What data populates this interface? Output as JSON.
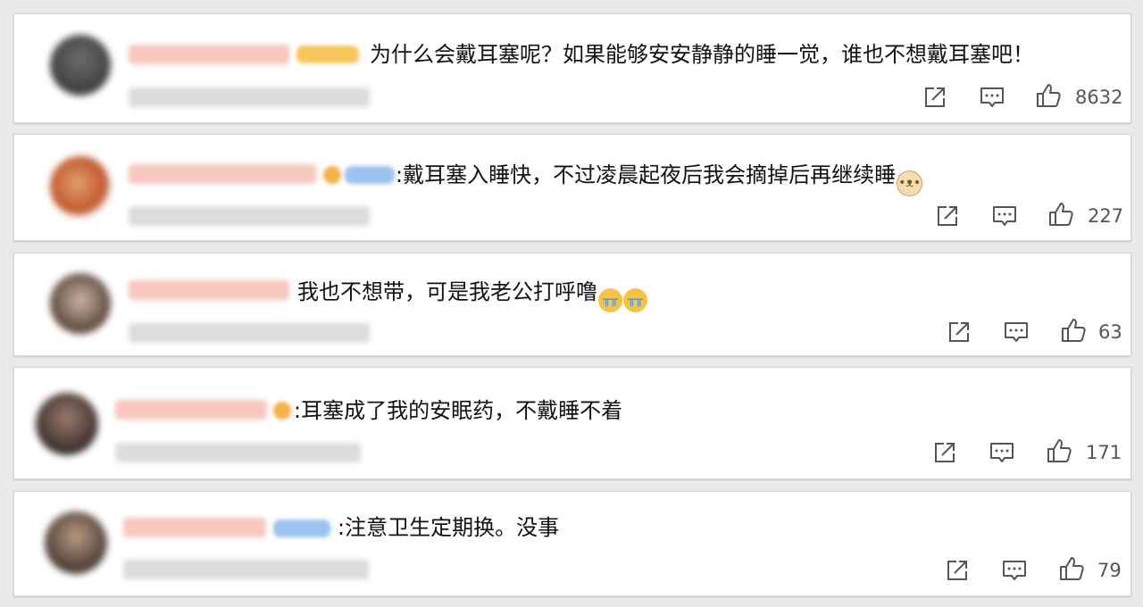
{
  "comments": [
    {
      "text": "为什么会戴耳塞呢？如果能够安安静静的睡一觉，谁也不想戴耳塞吧！",
      "emojis": [],
      "like_count": "8632",
      "badge_color": "#f6c65a"
    },
    {
      "text": ":戴耳塞入睡快，不过凌晨起夜后我会摘掉后再继续睡",
      "emojis": [
        "doge"
      ],
      "like_count": "227",
      "badge_color": "#9cc3f0"
    },
    {
      "text": "我也不想带，可是我老公打呼噜",
      "emojis": [
        "cry",
        "cry"
      ],
      "like_count": "63",
      "badge_color": ""
    },
    {
      "text": ":耳塞成了我的安眠药，不戴睡不着",
      "emojis": [],
      "like_count": "171",
      "badge_color": "#f6b14a"
    },
    {
      "text": ":注意卫生定期换。没事",
      "emojis": [],
      "like_count": "79",
      "badge_color": "#9cc3f0"
    }
  ],
  "icons": {
    "share": "share-icon",
    "comment": "comment-icon",
    "like": "thumbs-up-icon"
  },
  "colors": {
    "icon_stroke": "#555555",
    "name_blur": "#f7c7bd"
  }
}
